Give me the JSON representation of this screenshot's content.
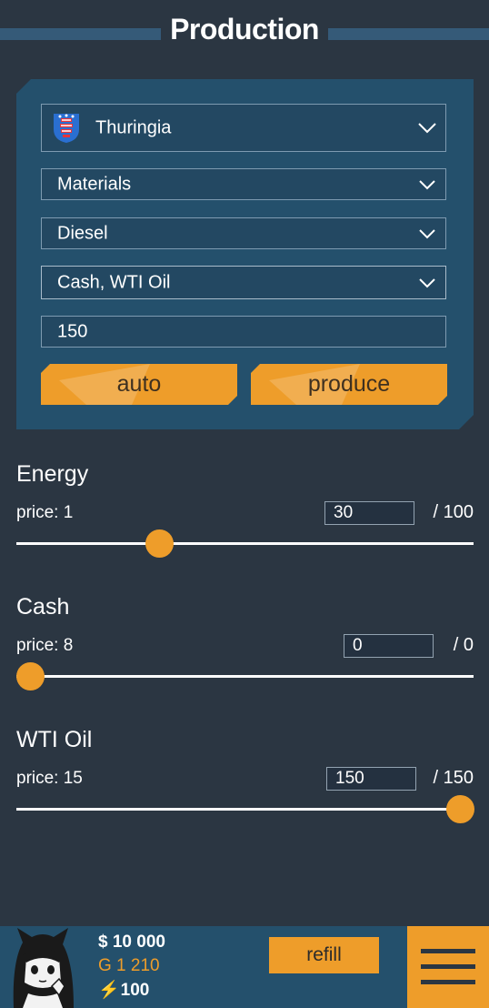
{
  "header": {
    "title": "Production"
  },
  "form": {
    "region": "Thuringia",
    "category": "Materials",
    "product": "Diesel",
    "resources": "Cash, WTI Oil",
    "quantity": "150",
    "auto_label": "auto",
    "produce_label": "produce"
  },
  "resources": [
    {
      "name": "Energy",
      "price": "price: 1",
      "value": "30",
      "max": "/ 100",
      "fraction": 0.3
    },
    {
      "name": "Cash",
      "price": "price: 8",
      "value": "0",
      "max": "/ 0",
      "fraction": 0
    },
    {
      "name": "WTI Oil",
      "price": "price: 15",
      "value": "150",
      "max": "/ 150",
      "fraction": 1
    }
  ],
  "footer": {
    "money": "$ 10 000",
    "gold": "G 1 210",
    "energy_icon": "⚡",
    "energy": "100",
    "refill_label": "refill"
  },
  "colors": {
    "accent": "#ee9d2a",
    "background": "#2b3642",
    "panel": "#24506c"
  }
}
